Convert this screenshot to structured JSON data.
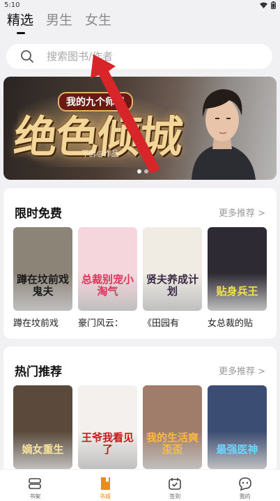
{
  "status_bar": {
    "time": "5:10"
  },
  "top_tabs": [
    {
      "label": "精选",
      "active": true
    },
    {
      "label": "男生",
      "active": false
    },
    {
      "label": "女生",
      "active": false
    }
  ],
  "search": {
    "placeholder": "搜索图书/作者"
  },
  "banner": {
    "tag": "我的九个师姐",
    "title": "绝色倾城",
    "author": "不醉◎作品",
    "dots": 2
  },
  "sections": [
    {
      "title": "限时免费",
      "more": "更多推荐 >",
      "books": [
        {
          "name": "蹲在坟前戏",
          "cover_text": "蹲在坟前戏鬼夫",
          "cover_bg": "#8d8478",
          "text_color": "#1c1c1c"
        },
        {
          "name": "豪门风云：",
          "cover_text": "总裁别宠小淘气",
          "cover_bg": "#f6d6dd",
          "text_color": "#e0325a"
        },
        {
          "name": "《田园有",
          "cover_text": "贤夫养成计划",
          "cover_bg": "#f0ece4",
          "text_color": "#3b2a45"
        },
        {
          "name": "女总裁的贴",
          "cover_text": "贴身兵王",
          "cover_bg": "#2e2a33",
          "text_color": "#f1e24d"
        }
      ]
    },
    {
      "title": "热门推荐",
      "more": "更多推荐 >",
      "books": [
        {
          "name": "",
          "cover_text": "嫡女重生",
          "cover_bg": "#5b4a3c",
          "text_color": "#f7e39a"
        },
        {
          "name": "",
          "cover_text": "王爷我看见了",
          "cover_bg": "#f3f0ee",
          "text_color": "#c41a1a"
        },
        {
          "name": "",
          "cover_text": "我的生活爽歪歪",
          "cover_bg": "#a07c6a",
          "text_color": "#ffb93c"
        },
        {
          "name": "",
          "cover_text": "最强医神",
          "cover_bg": "#3b4d72",
          "text_color": "#6fd3ff"
        }
      ]
    }
  ],
  "bottom_nav": [
    {
      "label": "书架",
      "icon": "bookshelf-icon",
      "active": false
    },
    {
      "label": "书城",
      "icon": "bookstore-icon",
      "active": true
    },
    {
      "label": "签到",
      "icon": "checkin-icon",
      "active": false
    },
    {
      "label": "我的",
      "icon": "profile-icon",
      "active": false
    }
  ],
  "colors": {
    "accent": "#f08a16",
    "background": "#f1f1f3",
    "annotation_arrow": "#d8252a"
  }
}
